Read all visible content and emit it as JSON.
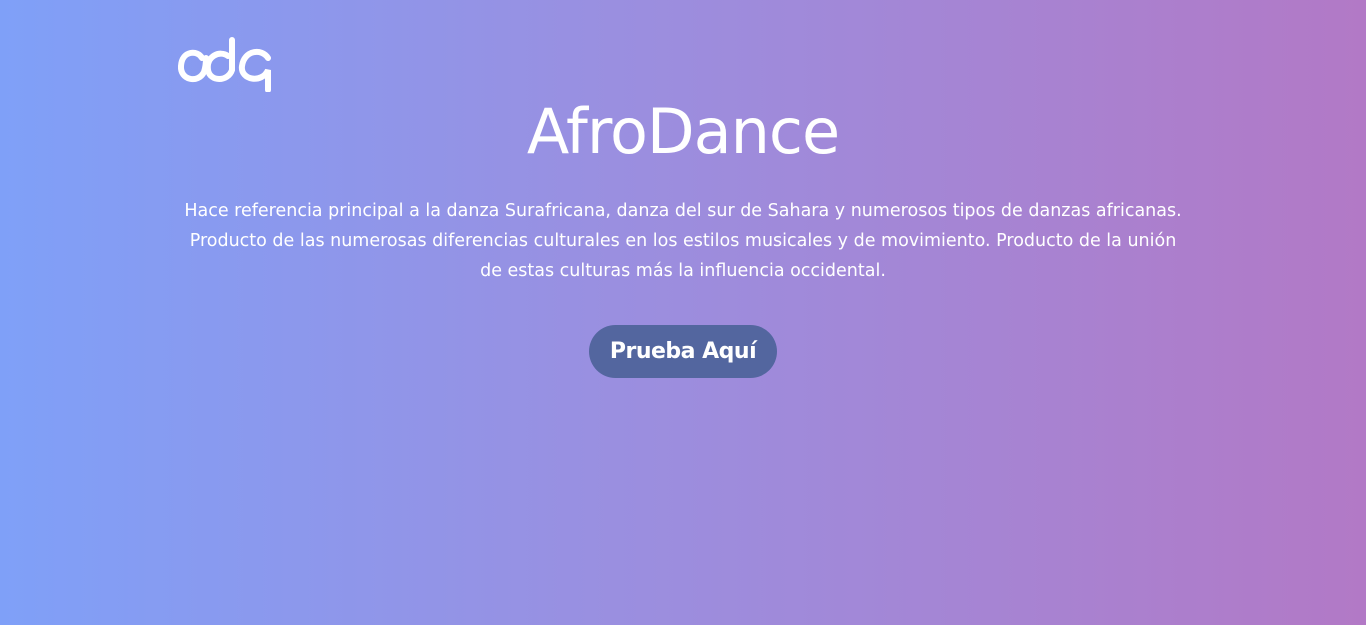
{
  "brand": {
    "logo_icon": "ada-logo-icon"
  },
  "hero": {
    "title": "AfroDance",
    "description": "Hace referencia principal a la danza Surafricana, danza del sur de Sahara y numerosos tipos de danzas africanas. Producto de las numerosas diferencias culturales en los estilos musicales y de movimiento. Producto de la unión de estas culturas más la influencia occidental.",
    "cta_label": "Prueba Aquí"
  },
  "colors": {
    "gradient_start": "#7fa0f8",
    "gradient_end": "#b279c6",
    "button_bg": "#53669f",
    "text": "#ffffff"
  }
}
